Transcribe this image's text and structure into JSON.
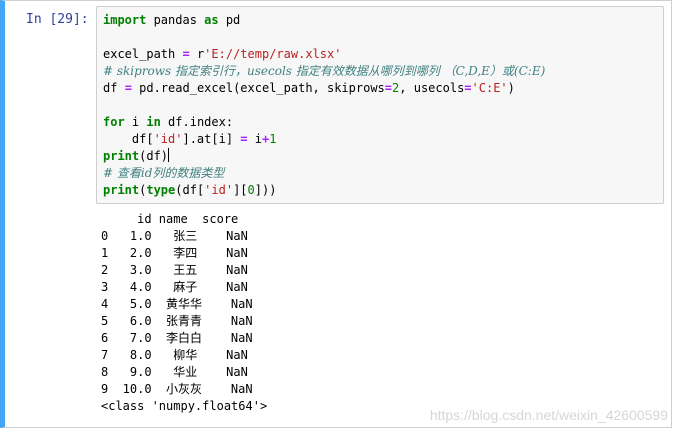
{
  "cell": {
    "prompt": "In  [29]:",
    "code": {
      "line1": {
        "kw1": "import",
        "t1": " pandas ",
        "kw2": "as",
        "t2": " pd"
      },
      "line2": "",
      "line3": {
        "t1": "excel_path ",
        "op": "=",
        "t2": " r",
        "str": "'E://temp/raw.xlsx'"
      },
      "line4": "# skiprows 指定索引行，usecols 指定有效数据从哪列到哪列 （C,D,E）或(C:E)",
      "line5": {
        "t1": "df ",
        "op": "=",
        "t2": " pd.read_excel(excel_path, skiprows",
        "op2": "=",
        "num": "2",
        "t3": ", usecols",
        "op3": "=",
        "str": "'C:E'",
        "t4": ")"
      },
      "line6": "",
      "line7": {
        "kw1": "for",
        "t1": " i ",
        "kw2": "in",
        "t2": " df.index:"
      },
      "line8": {
        "t1": "    df[",
        "str": "'id'",
        "t2": "].at[i] ",
        "op": "=",
        "t3": " i",
        "op2": "+",
        "num": "1"
      },
      "line9": {
        "kw": "print",
        "t1": "(df)"
      },
      "line10": "# 查看id列的数据类型",
      "line11": {
        "kw": "print",
        "t1": "(",
        "kw2": "type",
        "t2": "(df[",
        "str": "'id'",
        "t3": "][",
        "num": "0",
        "t4": "]))"
      }
    }
  },
  "output": {
    "header": "     id name  score",
    "rows": [
      "0   1.0   张三    NaN",
      "1   2.0   李四    NaN",
      "2   3.0   王五    NaN",
      "3   4.0   麻子    NaN",
      "4   5.0  黄华华    NaN",
      "5   6.0  张青青    NaN",
      "6   7.0  李白白    NaN",
      "7   8.0   柳华    NaN",
      "8   9.0   华业    NaN",
      "9  10.0  小灰灰    NaN"
    ],
    "type_line": "<class 'numpy.float64'>"
  },
  "watermark": "https://blog.csdn.net/weixin_42600599",
  "colors": {
    "cell_border_active": "#42a5f5",
    "prompt": "#303f9f",
    "keyword": "#008000",
    "string": "#ba2121",
    "comment": "#408080",
    "operator": "#aa22ff",
    "input_bg": "#f7f7f7"
  }
}
